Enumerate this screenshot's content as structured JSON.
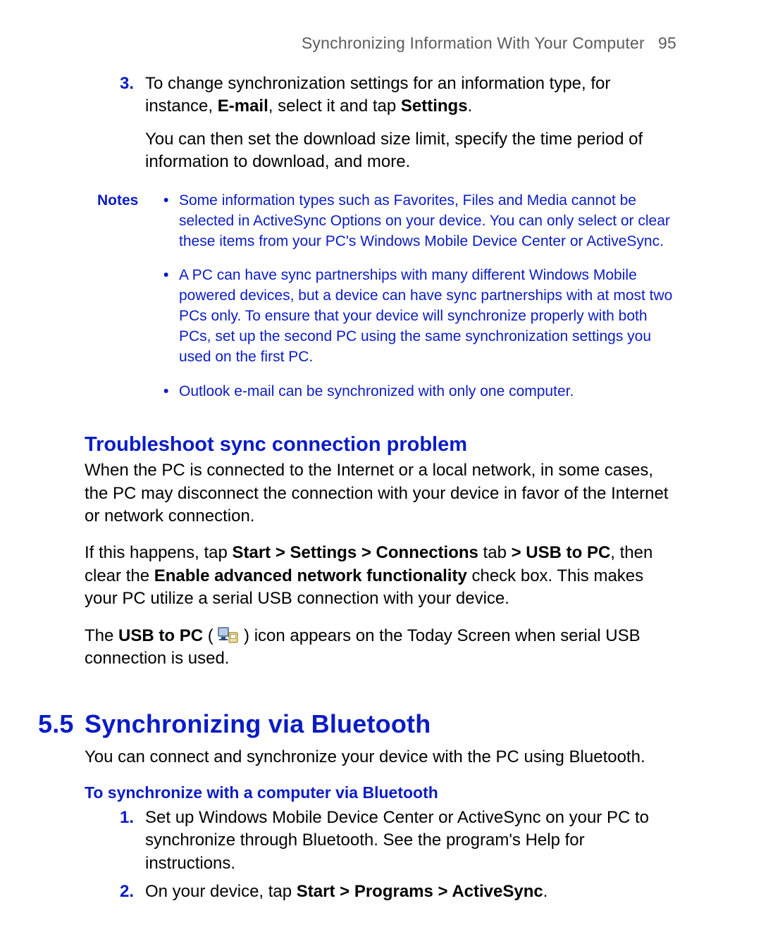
{
  "running_head": {
    "title": "Synchronizing Information With Your Computer",
    "page": "95"
  },
  "step3": {
    "num": "3.",
    "body_html": "To change synchronization settings for an information type, for instance, <b>E-mail</b>, select it and tap <b>Settings</b>.",
    "continue": "You can then set the download size limit, specify the time period of information to download, and more."
  },
  "notes": {
    "label": "Notes",
    "items": [
      "Some information types such as Favorites, Files and Media cannot be selected in ActiveSync Options on your device. You can only select or clear these items from your PC's Windows Mobile Device Center or ActiveSync.",
      "A PC can have sync partnerships with many different Windows Mobile powered devices, but a device can have sync partnerships with at most two PCs only. To ensure that your device will synchronize properly with both PCs, set up the second PC using the same synchronization settings you used on the first PC.",
      "Outlook e-mail can be synchronized with only one computer."
    ]
  },
  "troubleshoot": {
    "heading": "Troubleshoot sync connection problem",
    "p1": "When the PC is connected to the Internet or a local network, in some cases, the PC may disconnect the connection with your device in favor of the Internet or network connection.",
    "p2_html": "If this happens, tap <b>Start &gt; Settings &gt; Connections</b> tab <b>&gt; USB to PC</b>, then clear the <b>Enable advanced network functionality</b> check box. This makes your PC utilize a serial USB connection with your device.",
    "p3_pre_html": "The <b>USB to PC</b> ( ",
    "p3_post": " ) icon appears on the Today Screen when serial USB connection is used."
  },
  "section55": {
    "num": "5.5",
    "title": "Synchronizing via Bluetooth",
    "intro": "You can connect and synchronize your device with the PC using Bluetooth.",
    "task_title": "To synchronize with a computer via Bluetooth",
    "steps": [
      {
        "num": "1.",
        "body": "Set up Windows Mobile Device Center or ActiveSync on your PC to synchronize through Bluetooth. See the program's Help for instructions."
      },
      {
        "num": "2.",
        "body_html": "On your device, tap <b>Start &gt; Programs &gt; ActiveSync</b>."
      }
    ]
  }
}
